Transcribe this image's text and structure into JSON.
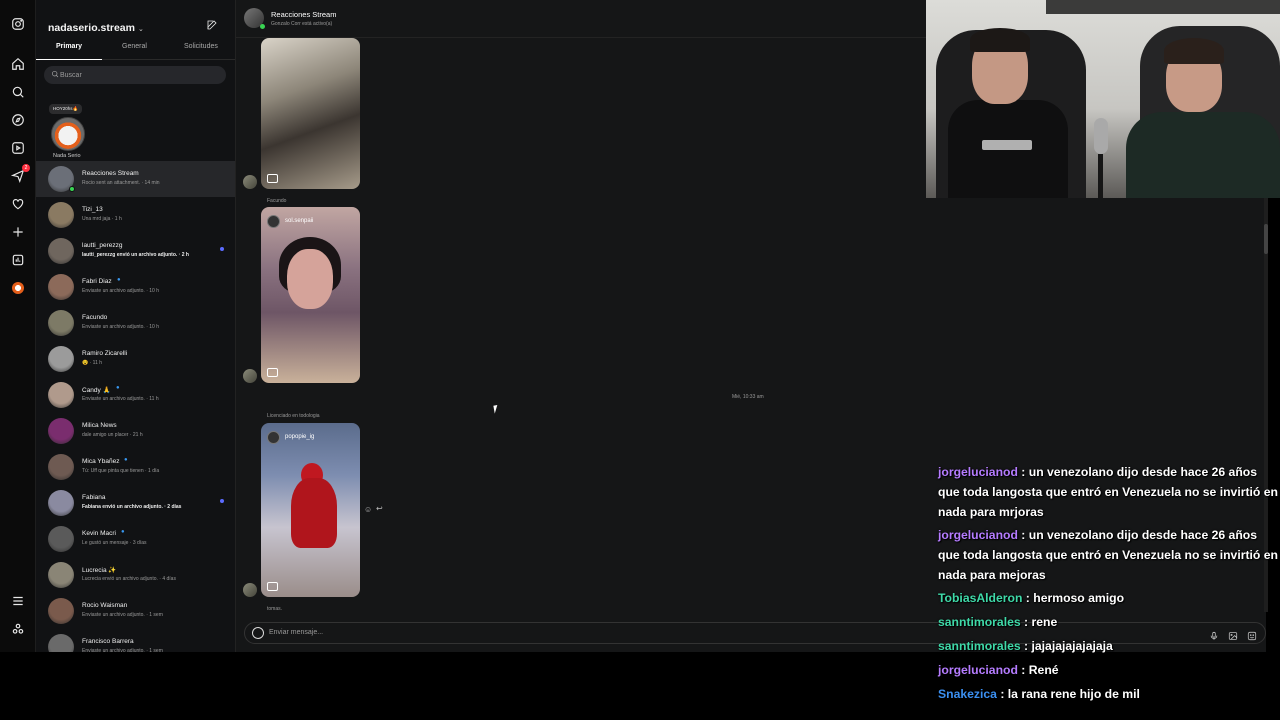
{
  "inbox": {
    "account_name": "nadaserio.stream",
    "tabs": [
      "Primary",
      "General",
      "Solicitudes"
    ],
    "search_placeholder": "Buscar",
    "note_text": "HOY20hs🔥",
    "note_owner": "Nada Serio",
    "conversations": [
      {
        "name": "Reacciones Stream",
        "sub": "Rocio sent an attachment. · 14 min",
        "selected": true,
        "online": true,
        "bold": false,
        "unread": false,
        "verified": false,
        "color": "#6b6f78"
      },
      {
        "name": "Tizi_13",
        "sub": "Una mrd jaja · 1 h",
        "selected": false,
        "online": false,
        "bold": false,
        "unread": false,
        "verified": false,
        "color": "#8a7a62"
      },
      {
        "name": "lautti_perezzg",
        "sub": "lautti_perezzg envió un archivo adjunto. · 2 h",
        "selected": false,
        "online": false,
        "bold": true,
        "unread": true,
        "verified": false,
        "color": "#6f665e"
      },
      {
        "name": "Fabri Diaz",
        "sub": "Enviaste un archivo adjunto. · 10 h",
        "selected": false,
        "online": false,
        "bold": false,
        "unread": false,
        "verified": true,
        "color": "#8c6a5a"
      },
      {
        "name": "Facundo",
        "sub": "Enviaste un archivo adjunto. · 10 h",
        "selected": false,
        "online": false,
        "bold": false,
        "unread": false,
        "verified": false,
        "color": "#7d7a66"
      },
      {
        "name": "Ramiro Zicarelli",
        "sub": "😵 · 11 h",
        "selected": false,
        "online": false,
        "bold": false,
        "unread": false,
        "verified": false,
        "color": "#9b9b9b"
      },
      {
        "name": "Candy 🙏",
        "sub": "Enviaste un archivo adjunto. · 11 h",
        "selected": false,
        "online": false,
        "bold": false,
        "unread": false,
        "verified": true,
        "color": "#b09a8c"
      },
      {
        "name": "Milica News",
        "sub": "dale amigo un placer · 21 h",
        "selected": false,
        "online": false,
        "bold": false,
        "unread": false,
        "verified": false,
        "color": "#7a2d6e"
      },
      {
        "name": "Mica Ybañez",
        "sub": "Tú: Uff que pinta que tienen · 1 día",
        "selected": false,
        "online": false,
        "bold": false,
        "unread": false,
        "verified": true,
        "color": "#6e5a52"
      },
      {
        "name": "Fabiana",
        "sub": "Fabiana envió un archivo adjunto. · 2 días",
        "selected": false,
        "online": false,
        "bold": true,
        "unread": true,
        "verified": false,
        "color": "#8a8aa0"
      },
      {
        "name": "Kevin Macri",
        "sub": "Le gustó un mensaje · 3 días",
        "selected": false,
        "online": false,
        "bold": false,
        "unread": false,
        "verified": true,
        "color": "#5a5a5a"
      },
      {
        "name": "Lucrecia ✨",
        "sub": "Lucrecia envió un archivo adjunto. · 4 días",
        "selected": false,
        "online": false,
        "bold": false,
        "unread": false,
        "verified": false,
        "color": "#8a8576"
      },
      {
        "name": "Rocio Waisman",
        "sub": "Enviaste un archivo adjunto. · 1 sem",
        "selected": false,
        "online": false,
        "bold": false,
        "unread": false,
        "verified": false,
        "color": "#7a5a4c"
      },
      {
        "name": "Francisco Barrera",
        "sub": "Enviaste un archivo adjunto. · 1 sem",
        "selected": false,
        "online": false,
        "bold": false,
        "unread": false,
        "verified": false,
        "color": "#6a6a6a"
      }
    ]
  },
  "chat": {
    "title": "Reacciones Stream",
    "subtitle": "Gonzalo Corr está activo(a)",
    "sender_facundo": "Facundo",
    "photo2_handle": "sol.senpaii",
    "timestamp": "Mié, 10:33 am",
    "sender_licenciado": "Licenciado en todologia",
    "photo3_handle": "popopie_ig",
    "sender_tomas": "tomas.",
    "composer_placeholder": "Enviar mensaje..."
  },
  "stream_chat": [
    {
      "user": "jorgelucianod",
      "color": "#b57cff",
      "text": "un venezolano dijo desde hace 26 años que toda langosta que entró en Venezuela no se invirtió en nada para mrjoras"
    },
    {
      "user": "jorgelucianod",
      "color": "#b57cff",
      "text": "un venezolano dijo desde hace 26 años que toda langosta que entró en Venezuela no se invirtió en nada para mejoras"
    },
    {
      "user": "TobiasAlderon",
      "color": "#3fd9a8",
      "text": "hermoso amigo"
    },
    {
      "user": "sanntimorales",
      "color": "#3fd9a8",
      "text": "rene"
    },
    {
      "user": "sanntimorales",
      "color": "#3fd9a8",
      "text": "jajajajajajajaja"
    },
    {
      "user": "jorgelucianod",
      "color": "#b57cff",
      "text": "René"
    },
    {
      "user": "Snakezica",
      "color": "#3b8ff0",
      "text": "la rana rene hijo de mil"
    }
  ]
}
